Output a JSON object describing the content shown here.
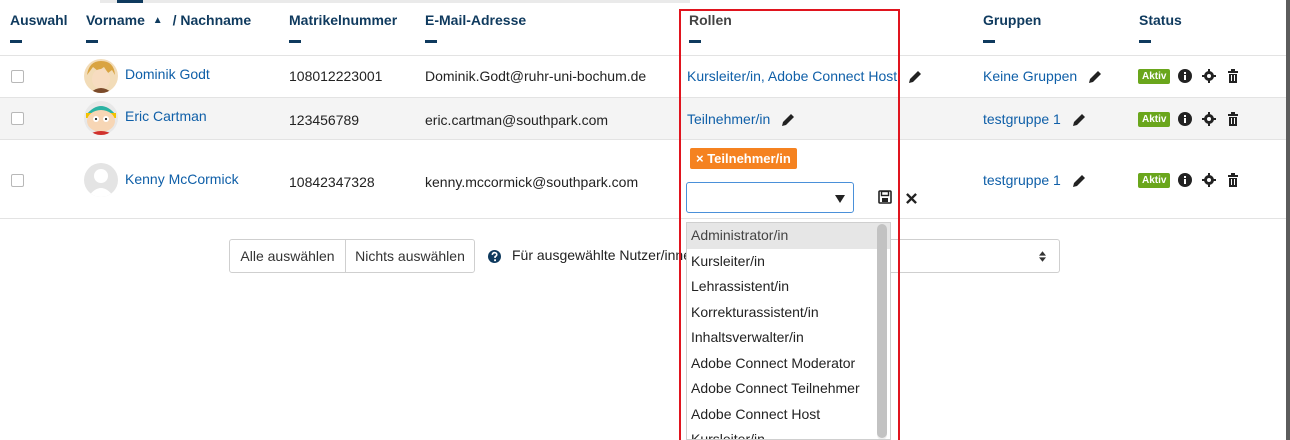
{
  "table": {
    "headers": {
      "auswahl": "Auswahl",
      "vorname": "Vorname",
      "sort_indicator": "▲",
      "nachname": "/ Nachname",
      "matrikel": "Matrikelnummer",
      "email": "E-Mail-Adresse",
      "rollen": "Rollen",
      "gruppen": "Gruppen",
      "status": "Status"
    },
    "rows": [
      {
        "name": "Dominik Godt",
        "matrikel": "108012223001",
        "email": "Dominik.Godt@ruhr-uni-bochum.de",
        "roles": "Kursleiter/in, Adobe Connect Host",
        "groups": "Keine Gruppen",
        "status": "Aktiv"
      },
      {
        "name": "Eric Cartman",
        "matrikel": "123456789",
        "email": "eric.cartman@southpark.com",
        "roles": "Teilnehmer/in",
        "groups": "testgruppe 1",
        "status": "Aktiv"
      },
      {
        "name": "Kenny McCormick",
        "matrikel": "10842347328",
        "email": "kenny.mccormick@southpark.com",
        "role_tag": "× Teilnehmer/in",
        "groups": "testgruppe 1",
        "status": "Aktiv"
      }
    ]
  },
  "role_dropdown": {
    "selected": "",
    "options": [
      "Administrator/in",
      "Kursleiter/in",
      "Lehrassistent/in",
      "Korrekturassistent/in",
      "Inhaltsverwalter/in",
      "Adobe Connect Moderator",
      "Adobe Connect Teilnehmer",
      "Adobe Connect Host",
      "Kursleiter/in"
    ]
  },
  "bulk": {
    "select_all": "Alle auswählen",
    "select_none": "Nichts auswählen",
    "action_label": "Für ausgewählte Nutzer/innen"
  },
  "colors": {
    "link": "#0f5fa8",
    "header": "#0f3a5e",
    "active_badge": "#6aa61c",
    "role_tag": "#f58220",
    "highlight_border": "#e0141e"
  }
}
